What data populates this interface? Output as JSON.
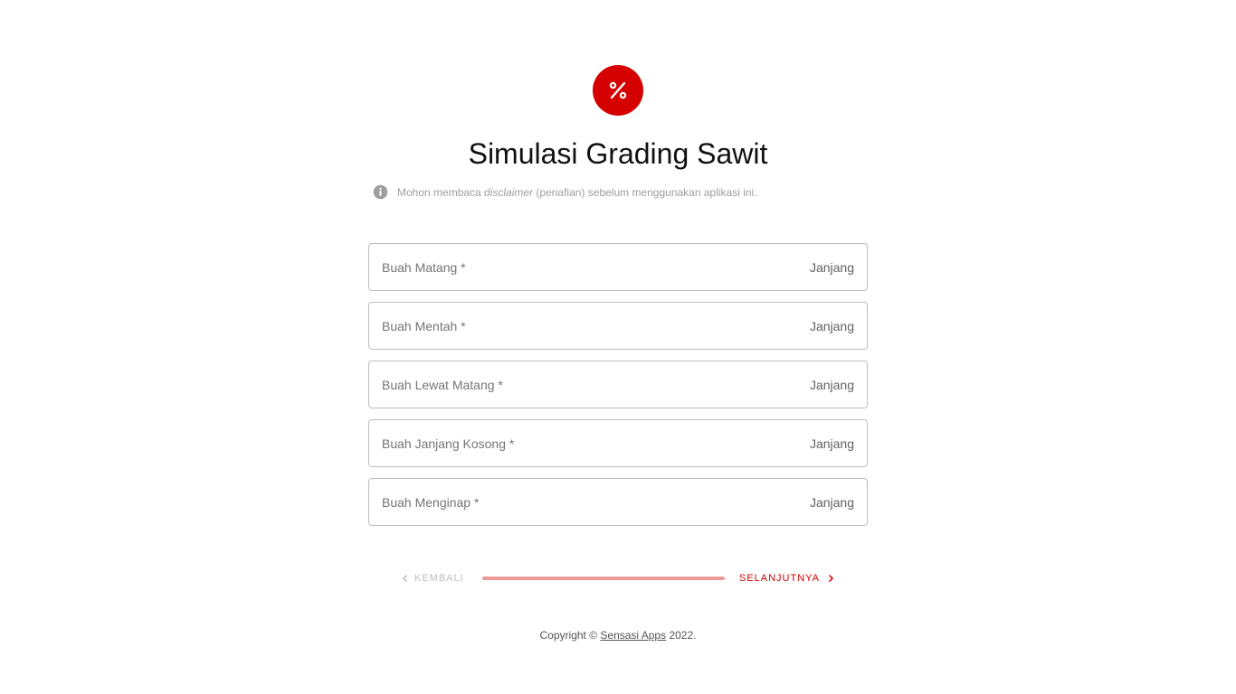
{
  "brand": {
    "logo_icon": "percent-icon",
    "accent_color": "#d50000"
  },
  "header": {
    "title": "Simulasi Grading Sawit"
  },
  "notice": {
    "icon": "info-icon",
    "text_before": "Mohon membaca ",
    "text_emphasis": "disclaimer",
    "text_after": " (penafian) sebelum menggunakan aplikasi ini."
  },
  "form": {
    "fields": [
      {
        "placeholder": "Buah Matang *",
        "value": "",
        "suffix": "Janjang"
      },
      {
        "placeholder": "Buah Mentah *",
        "value": "",
        "suffix": "Janjang"
      },
      {
        "placeholder": "Buah Lewat Matang *",
        "value": "",
        "suffix": "Janjang"
      },
      {
        "placeholder": "Buah Janjang Kosong *",
        "value": "",
        "suffix": "Janjang"
      },
      {
        "placeholder": "Buah Menginap *",
        "value": "",
        "suffix": "Janjang"
      }
    ]
  },
  "stepper": {
    "back_label": "KEMBALI",
    "next_label": "SELANJUTNYA",
    "progress_fraction": 1.0
  },
  "footer": {
    "prefix": "Copyright © ",
    "link_text": "Sensasi Apps",
    "suffix": " 2022."
  }
}
